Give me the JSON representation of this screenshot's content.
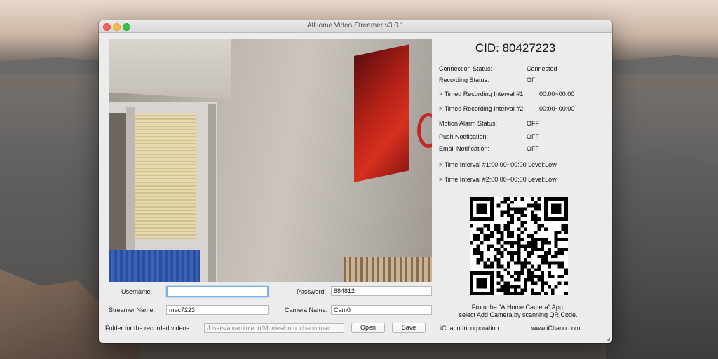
{
  "window": {
    "title": "AtHome Video Streamer v3.0.1"
  },
  "form": {
    "username_label": "Username:",
    "username_value": "",
    "password_label": "Password:",
    "password_value": "884812",
    "streamer_name_label": "Streamer Name:",
    "streamer_name_value": "mac7223",
    "camera_name_label": "Camera Name:",
    "camera_name_value": "Cam0",
    "folder_label": "Folder for the recorded videos:",
    "folder_value": "/Users/alvarotoledo/Movies/com.ichano.mac",
    "open_label": "Open",
    "save_label": "Save"
  },
  "status": {
    "cid": "CID: 80427223",
    "connection_label": "Connection Status:",
    "connection_value": "Connected",
    "recording_label": "Recording Status:",
    "recording_value": "Off",
    "timed1_label": "> Timed Recording Interval #1:",
    "timed1_value": "00:00~00:00",
    "timed2_label": "> Timed Recording Interval #2:",
    "timed2_value": "00:00~00:00",
    "motion_label": "Motion Alarm Status:",
    "motion_value": "OFF",
    "push_label": "Push Notification:",
    "push_value": "OFF",
    "email_label": "Email Notification:",
    "email_value": "OFF",
    "interval1": "> Time Interval #1:00:00~00:00 Level:Low",
    "interval2": "> Time Interval #2:00:00~00:00 Level:Low"
  },
  "qr": {
    "caption_line1": "From the \"AtHome Camera\" App,",
    "caption_line2": "select Add Camera by scanning QR Code."
  },
  "footer": {
    "company": "iChano Incorporation",
    "website": "www.iChano.com"
  },
  "colors": {
    "focus_ring": "#7eaee8",
    "close": "#fc605c",
    "minimize": "#fdbc40",
    "zoom": "#34c84a"
  }
}
